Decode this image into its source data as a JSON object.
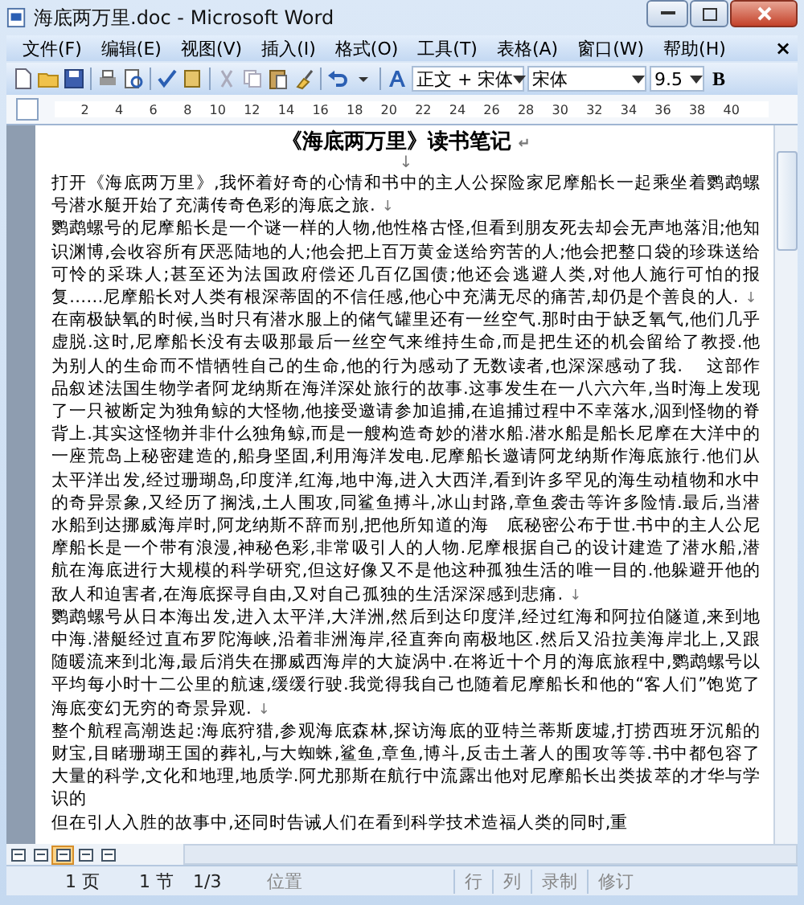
{
  "window": {
    "title": "海底两万里.doc - Microsoft Word"
  },
  "menu": [
    "文件(F)",
    "编辑(E)",
    "视图(V)",
    "插入(I)",
    "格式(O)",
    "工具(T)",
    "表格(A)",
    "窗口(W)",
    "帮助(H)"
  ],
  "menu_close": "×",
  "toolbar": {
    "style": "正文 + 宋体",
    "font": "宋体",
    "size": "9.5",
    "bold": "B"
  },
  "ruler": {
    "marks": [
      "2",
      "4",
      "6",
      "8",
      "10",
      "12",
      "14",
      "16",
      "18",
      "20",
      "22",
      "24",
      "26",
      "28",
      "30",
      "32",
      "34",
      "36",
      "38",
      "40"
    ]
  },
  "document": {
    "title": "《海底两万里》读书笔记",
    "title_mark": "↵",
    "blank_mark": "↓",
    "paragraphs": [
      {
        "text": "打开《海底两万里》,我怀着好奇的心情和书中的主人公探险家尼摩船长一起乘坐着鹦鹉螺号潜水艇开始了充满传奇色彩的海底之旅.",
        "mark": "↓"
      },
      {
        "text": "鹦鹉螺号的尼摩船长是一个谜一样的人物,他性格古怪,但看到朋友死去却会无声地落泪;他知识渊博,会收容所有厌恶陆地的人;他会把上百万黄金送给穷苦的人;他会把整口袋的珍珠送给可怜的采珠人;甚至还为法国政府偿还几百亿国债;他还会逃避人类,对他人施行可怕的报复……尼摩船长对人类有根深蒂固的不信任感,他心中充满无尽的痛苦,却仍是个善良的人.",
        "mark": "↓"
      },
      {
        "text": "在南极缺氧的时候,当时只有潜水服上的储气罐里还有一丝空气.那时由于缺乏氧气,他们几乎虚脱.这时,尼摩船长没有去吸那最后一丝空气来维持生命,而是把生还的机会留给了教授.他为别人的生命而不惜牺牲自己的生命,他的行为感动了无数读者,也深深感动了我.　 这部作品叙述法国生物学者阿龙纳斯在海洋深处旅行的故事.这事发生在一八六六年,当时海上发现了一只被断定为独角鲸的大怪物,他接受邀请参加追捕,在追捕过程中不幸落水,泅到怪物的脊背上.其实这怪物并非什么独角鲸,而是一艘构造奇妙的潜水船.潜水船是船长尼摩在大洋中的一座荒岛上秘密建造的,船身坚固,利用海洋发电.尼摩船长邀请阿龙纳斯作海底旅行.他们从太平洋出发,经过珊瑚岛,印度洋,红海,地中海,进入大西洋,看到许多罕见的海生动植物和水中的奇异景象,又经历了搁浅,土人围攻,同鲨鱼搏斗,冰山封路,章鱼袭击等许多险情.最后,当潜水船到达挪威海岸时,阿龙纳斯不辞而别,把他所知道的海　底秘密公布于世.书中的主人公尼摩船长是一个带有浪漫,神秘色彩,非常吸引人的人物.尼摩根据自己的设计建造了潜水船,潜航在海底进行大规模的科学研究,但这好像又不是他这种孤独生活的唯一目的.他躲避开他的敌人和迫害者,在海底探寻自由,又对自己孤独的生活深深感到悲痛.",
        "mark": "↓"
      },
      {
        "text": "鹦鹉螺号从日本海出发,进入太平洋,大洋洲,然后到达印度洋,经过红海和阿拉伯隧道,来到地中海.潜艇经过直布罗陀海峡,沿着非洲海岸,径直奔向南极地区.然后又沿拉美海岸北上,又跟随暖流来到北海,最后消失在挪威西海岸的大旋涡中.在将近十个月的海底旅程中,鹦鹉螺号以平均每小时十二公里的航速,缓缓行驶.我觉得我自己也随着尼摩船长和他的“客人们”饱览了海底变幻无穷的奇景异观.",
        "mark": "↓"
      },
      {
        "text": "整个航程高潮迭起:海底狩猎,参观海底森林,探访海底的亚特兰蒂斯废墟,打捞西班牙沉船的财宝,目睹珊瑚王国的葬礼,与大蜘蛛,鲨鱼,章鱼,博斗,反击土著人的围攻等等.书中都包容了大量的科学,文化和地理,地质学.阿尤那斯在航行中流露出他对尼摩船长出类拔萃的才华与学识的"
      },
      {
        "text": "但在引人入胜的故事中,还同时告诫人们在看到科学技术造福人类的同时,重"
      }
    ]
  },
  "view_buttons": [
    {
      "selected": false
    },
    {
      "selected": false
    },
    {
      "selected": true
    },
    {
      "selected": false
    },
    {
      "selected": false
    }
  ],
  "status_bar": [
    "1 页",
    "1 节",
    "1/3",
    "位置",
    "行",
    "列",
    "录制",
    "修订"
  ]
}
